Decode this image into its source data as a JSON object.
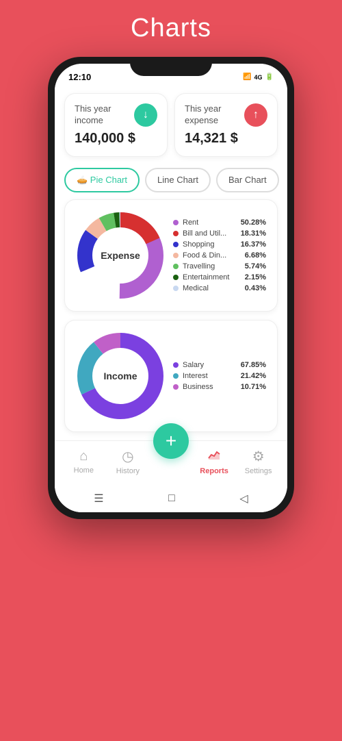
{
  "page": {
    "title": "Charts",
    "background_color": "#e8505b"
  },
  "status_bar": {
    "time": "12:10",
    "battery": "80",
    "signal": "4G"
  },
  "summary_cards": [
    {
      "label": "This year income",
      "amount": "140,000 $",
      "icon": "↓",
      "icon_color": "#2dc9a0"
    },
    {
      "label": "This year expense",
      "amount": "14,321 $",
      "icon": "↑",
      "icon_color": "#e8505b"
    }
  ],
  "chart_tabs": [
    {
      "label": "🥧 Pie Chart",
      "active": true
    },
    {
      "label": "Line Chart",
      "active": false
    },
    {
      "label": "Bar Chart",
      "active": false
    }
  ],
  "expense_chart": {
    "center_label": "Expense",
    "legend": [
      {
        "name": "Rent",
        "pct": "50.28%",
        "color": "#b060d0"
      },
      {
        "name": "Bill and Util...",
        "pct": "18.31%",
        "color": "#d63030"
      },
      {
        "name": "Shopping",
        "pct": "16.37%",
        "color": "#3333cc"
      },
      {
        "name": "Food & Din...",
        "pct": "6.68%",
        "color": "#f4b8a0"
      },
      {
        "name": "Travelling",
        "pct": "5.74%",
        "color": "#60c060"
      },
      {
        "name": "Entertainment",
        "pct": "2.15%",
        "color": "#1a6010"
      },
      {
        "name": "Medical",
        "pct": "0.43%",
        "color": "#c8d8f0"
      }
    ]
  },
  "income_chart": {
    "center_label": "Income",
    "legend": [
      {
        "name": "Salary",
        "pct": "67.85%",
        "color": "#7b40e0"
      },
      {
        "name": "Interest",
        "pct": "21.42%",
        "color": "#40a8c0"
      },
      {
        "name": "Business",
        "pct": "10.71%",
        "color": "#c060c8"
      }
    ]
  },
  "bottom_nav": {
    "items": [
      {
        "label": "Home",
        "icon": "🏠",
        "active": false
      },
      {
        "label": "History",
        "icon": "🕐",
        "active": false
      },
      {
        "label": "+",
        "is_fab": true
      },
      {
        "label": "Reports",
        "icon": "📊",
        "active": true
      },
      {
        "label": "Settings",
        "icon": "⚙️",
        "active": false
      }
    ]
  }
}
